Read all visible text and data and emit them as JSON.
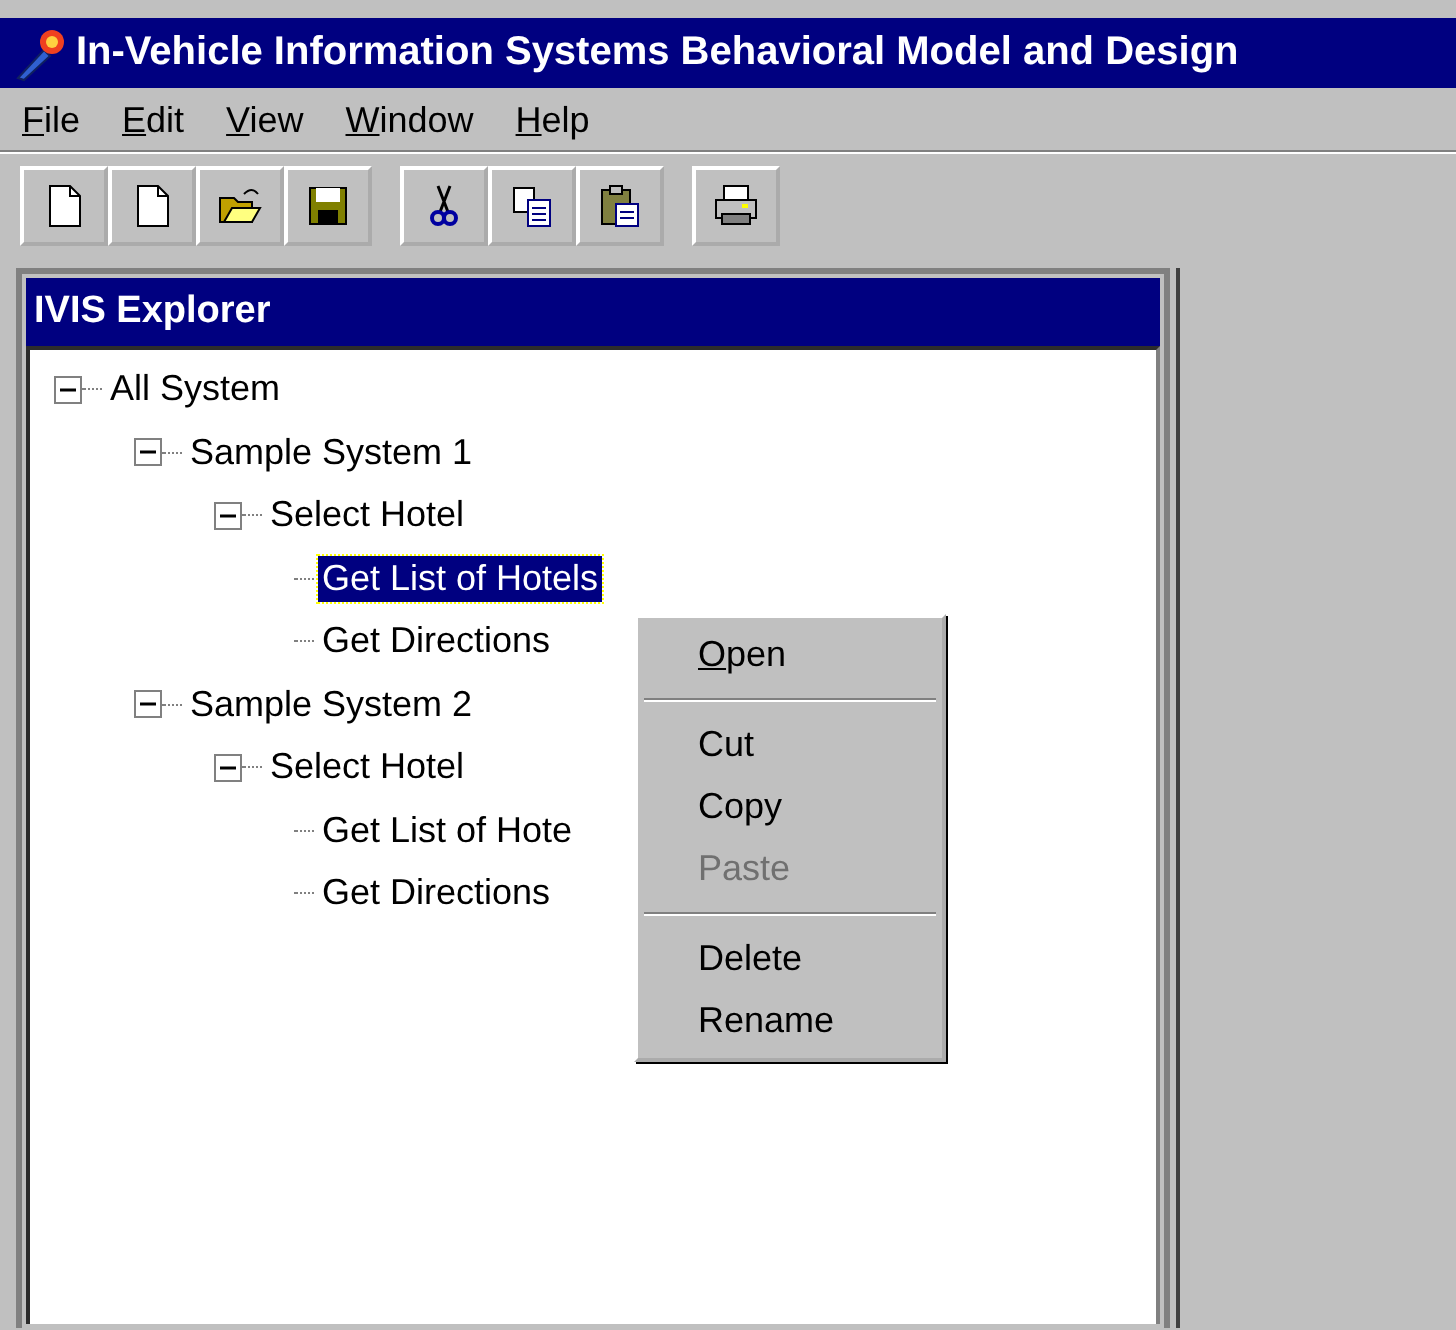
{
  "window": {
    "title": "In-Vehicle Information Systems Behavioral Model and Design"
  },
  "menu": [
    {
      "label": "File"
    },
    {
      "label": "Edit"
    },
    {
      "label": "View"
    },
    {
      "label": "Window"
    },
    {
      "label": "Help"
    }
  ],
  "toolbar": [
    {
      "kind": "new"
    },
    {
      "kind": "new"
    },
    {
      "kind": "open"
    },
    {
      "kind": "save"
    },
    {
      "kind": "sep"
    },
    {
      "kind": "cut"
    },
    {
      "kind": "copy"
    },
    {
      "kind": "paste"
    },
    {
      "kind": "sep"
    },
    {
      "kind": "print"
    }
  ],
  "explorer": {
    "title": "IVIS Explorer",
    "tree": [
      {
        "label": "All System",
        "expanded": true,
        "selected": false,
        "children": [
          {
            "label": "Sample System 1",
            "expanded": true,
            "selected": false,
            "children": [
              {
                "label": "Select Hotel",
                "expanded": true,
                "selected": false,
                "children": [
                  {
                    "label": "Get List of Hotels",
                    "selected": true
                  },
                  {
                    "label": "Get Directions",
                    "selected": false
                  }
                ]
              }
            ]
          },
          {
            "label": "Sample System 2",
            "expanded": true,
            "selected": false,
            "children": [
              {
                "label": "Select Hotel",
                "expanded": true,
                "selected": false,
                "children": [
                  {
                    "label": "Get List of Hote",
                    "selected": false
                  },
                  {
                    "label": "Get Directions",
                    "selected": false
                  }
                ]
              }
            ]
          }
        ]
      }
    ]
  },
  "context_menu": [
    {
      "kind": "item",
      "label": "Open",
      "mnemonic": true,
      "disabled": false
    },
    {
      "kind": "sep"
    },
    {
      "kind": "item",
      "label": "Cut",
      "mnemonic": false,
      "disabled": false
    },
    {
      "kind": "item",
      "label": "Copy",
      "mnemonic": false,
      "disabled": false
    },
    {
      "kind": "item",
      "label": "Paste",
      "mnemonic": false,
      "disabled": true
    },
    {
      "kind": "sep"
    },
    {
      "kind": "item",
      "label": "Delete",
      "mnemonic": false,
      "disabled": false
    },
    {
      "kind": "item",
      "label": "Rename",
      "mnemonic": false,
      "disabled": false
    }
  ]
}
